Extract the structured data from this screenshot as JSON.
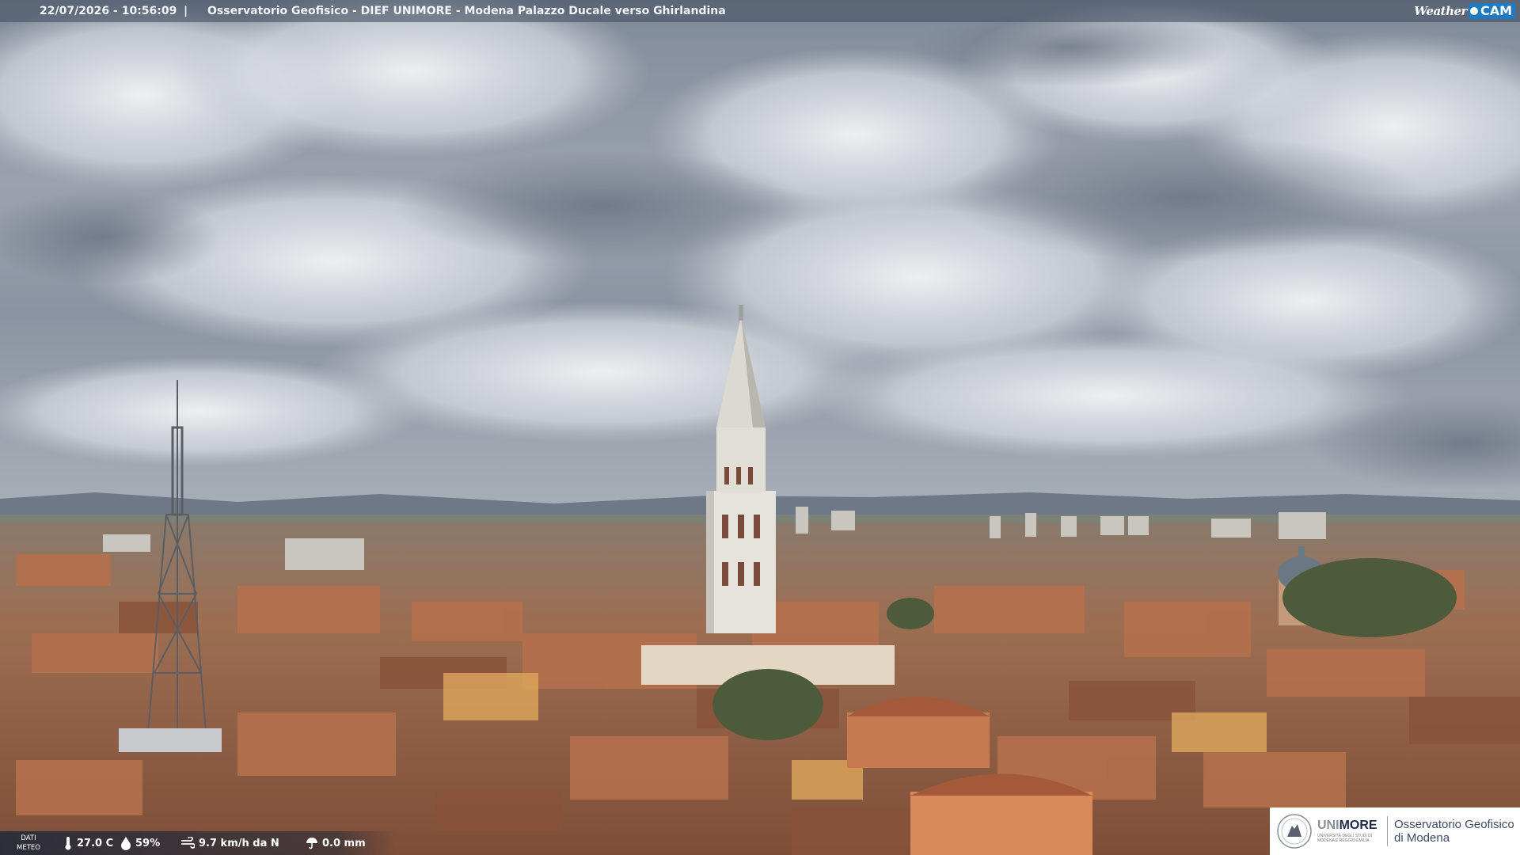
{
  "header": {
    "timestamp": "22/07/2026 - 10:56:09",
    "separator": "|",
    "title": "Osservatorio Geofisico - DIEF UNIMORE - Modena Palazzo Ducale verso Ghirlandina"
  },
  "brand": {
    "weather": "Weather",
    "cam": "CAM",
    "icon": "webcam-dot-icon"
  },
  "meteo": {
    "label": "DATI METEO",
    "temperature": "27.0 C",
    "humidity": "59%",
    "wind": "9.7 km/h da N",
    "rain": "0.0 mm",
    "icons": [
      "thermometer-icon",
      "droplet-icon",
      "wind-icon",
      "umbrella-icon"
    ]
  },
  "logo": {
    "university_a": "UNI",
    "university_b": "MORE",
    "university_sub": "UNIVERSITÀ DEGLI STUDI DI MODENA E REGGIO EMILIA",
    "observatory_line1": "Osservatorio Geofisico",
    "observatory_line2": "di Modena"
  },
  "colors": {
    "sky_light": "#e6e8ec",
    "sky_dark": "#5f6b7c",
    "roofs": "#a46a4c",
    "tower": "#e8e6e0",
    "brand_blue": "#1f7ac2"
  }
}
